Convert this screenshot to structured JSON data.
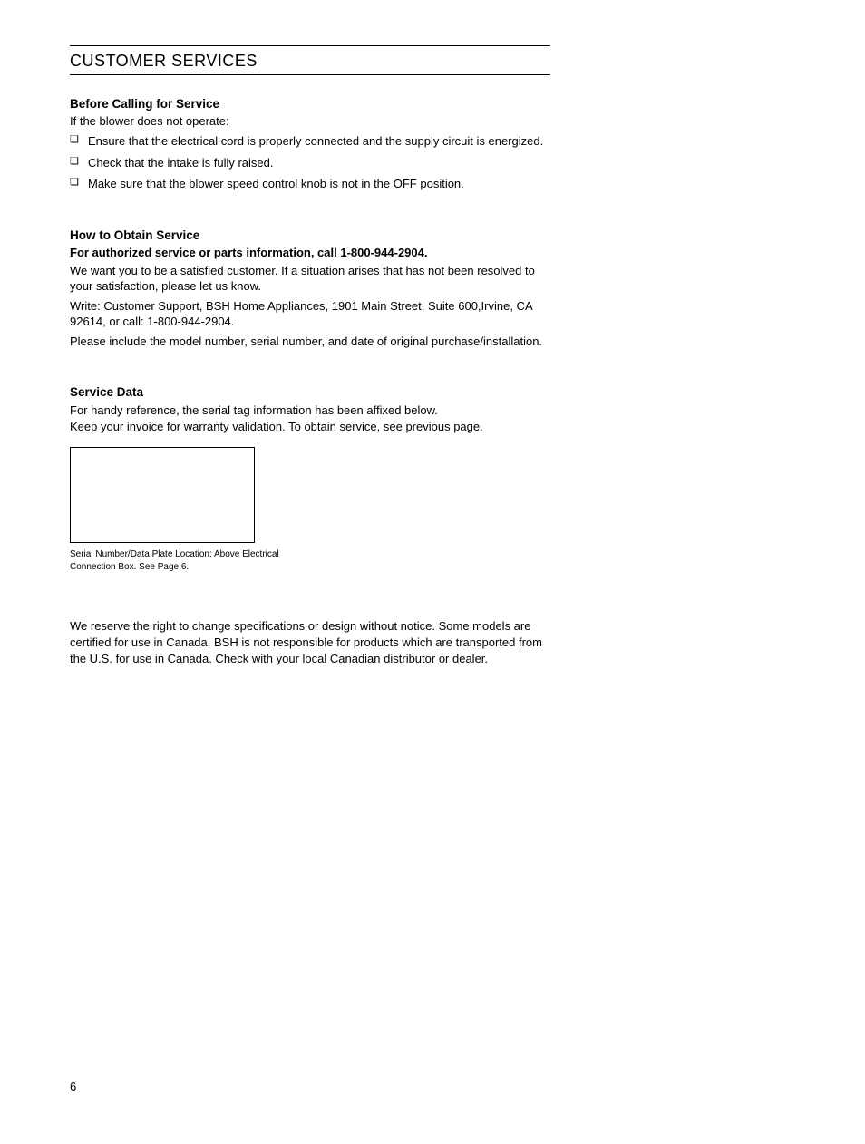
{
  "pageTitle": "CUSTOMER SERVICES",
  "beforeCalling": {
    "title": "Before Calling for Service",
    "lead": "If the blower does not operate:",
    "items": [
      "Ensure that the electrical cord is properly connected and the supply circuit is energized.",
      "Check that the intake is fully raised.",
      "Make sure that the blower speed control knob is not in the OFF position."
    ]
  },
  "howToObtain": {
    "title": "How to Obtain Service",
    "bold": "For authorized service or parts information, call 1-800-944-2904.",
    "p1": "We want you to be a satisfied customer. If a situation arises that has not been resolved to your satisfaction, please let us know.",
    "p2": "Write: Customer Support, BSH Home Appliances, 1901 Main Street, Suite 600,Irvine, CA 92614, or call: 1-800-944-2904.",
    "p3": "Please include the model number, serial number, and date of original purchase/installation."
  },
  "serviceData": {
    "title": "Service Data",
    "p1": "For handy reference, the serial tag information has been affixed below.",
    "p2": "Keep your invoice for warranty validation. To obtain service, see previous page.",
    "caption": "Serial Number/Data Plate Location: Above Electrical Connection Box. See Page 6."
  },
  "disclaimer": "We reserve the right to change specifications or design without notice. Some models are certified for use in Canada. BSH is not responsible for products which are transported from the U.S. for use in Canada. Check with your local Canadian distributor or dealer.",
  "pageNumber": "6"
}
